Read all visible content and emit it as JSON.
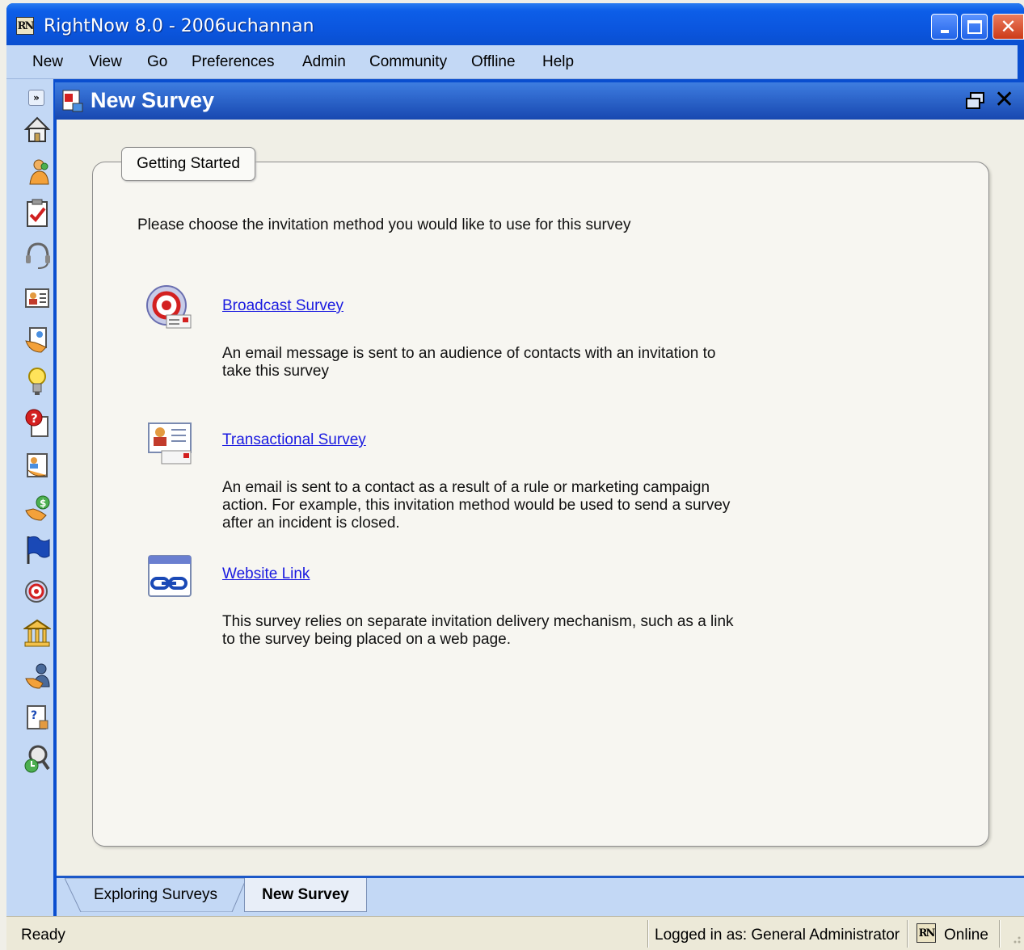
{
  "window": {
    "title": "RightNow 8.0 - 2006uchannan",
    "logo_text": "RN"
  },
  "menu": {
    "items": [
      "New",
      "View",
      "Go",
      "Preferences",
      "Admin",
      "Community",
      "Offline",
      "Help"
    ]
  },
  "sidebar": {
    "expand_glyph": "»",
    "icons": [
      "home-icon",
      "contacts-icon",
      "tasks-icon",
      "agent-headset-icon",
      "contact-card-icon",
      "opportunities-icon",
      "answers-lightbulb-icon",
      "incidents-icon",
      "organizations-icon",
      "sales-icon",
      "campaigns-flag-icon",
      "surveys-icon",
      "bank-icon",
      "staff-icon",
      "questions-icon",
      "reports-search-icon"
    ]
  },
  "panel": {
    "title": "New Survey"
  },
  "group": {
    "tab_label": "Getting Started",
    "instructions": "Please choose the invitation method you would like to use for this survey"
  },
  "options": [
    {
      "icon": "broadcast-survey-icon",
      "link": "Broadcast Survey",
      "description": "An email message is sent to an audience of contacts with an invitation to take this survey"
    },
    {
      "icon": "transactional-survey-icon",
      "link": "Transactional Survey",
      "description": "An email is sent to a contact as a result of a rule or marketing campaign action.  For example, this invitation method would be used to send a survey after an incident is closed."
    },
    {
      "icon": "website-link-icon",
      "link": "Website Link",
      "description": "This survey relies on separate invitation delivery mechanism, such as a link to the survey being placed on a web page."
    }
  ],
  "bottom_tabs": [
    "Exploring Surveys",
    "New Survey"
  ],
  "status": {
    "ready": "Ready",
    "login": "Logged in as: General Administrator",
    "online": "Online"
  },
  "colors": {
    "titlebar": "#0b56df",
    "menubar": "#c3d8f5",
    "panel_header": "#1848b0",
    "link": "#1a1ae0"
  }
}
